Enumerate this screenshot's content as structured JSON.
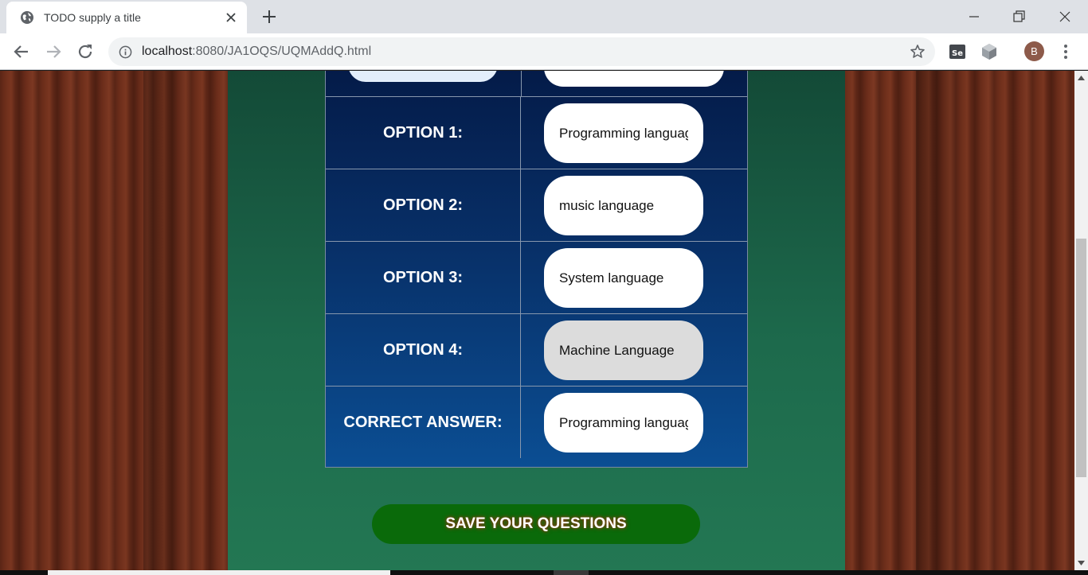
{
  "browser": {
    "tab_title": "TODO supply a title",
    "url_host": "localhost",
    "url_path": ":8080/JA1OQS/UQMAddQ.html",
    "profile_initial": "B"
  },
  "form": {
    "options": [
      {
        "label": "OPTION 1:",
        "value": "Programming languag"
      },
      {
        "label": "OPTION 2:",
        "value": "music language"
      },
      {
        "label": "OPTION 3:",
        "value": "System language"
      },
      {
        "label": "OPTION 4:",
        "value": "Machine Language"
      }
    ],
    "correct_answer": {
      "label": "CORRECT ANSWER:",
      "value": "Programming languag"
    },
    "save_label": "SAVE YOUR QUESTIONS"
  },
  "colors": {
    "panel_green": "#1d6a4c",
    "table_blue": "#08326b",
    "save_button": "#0a6a0a"
  }
}
